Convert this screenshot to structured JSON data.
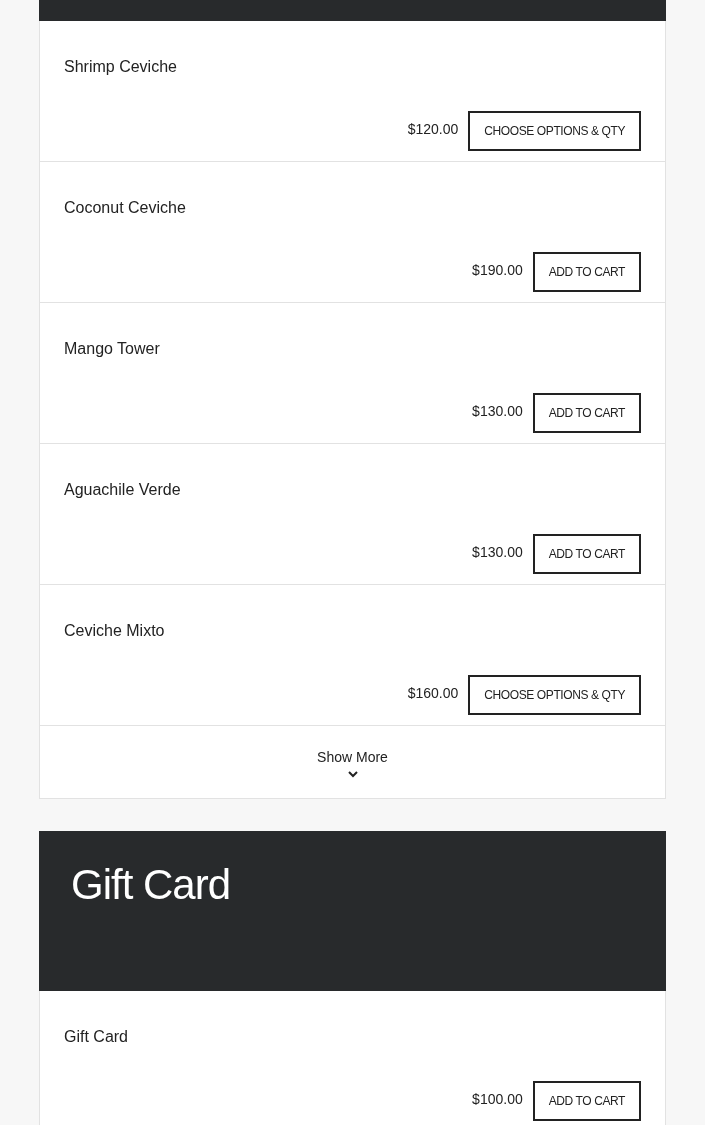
{
  "sections": [
    {
      "items": [
        {
          "name": "Shrimp Ceviche",
          "price": "$120.00",
          "button": "CHOOSE OPTIONS & QTY"
        },
        {
          "name": "Coconut Ceviche",
          "price": "$190.00",
          "button": "ADD TO CART"
        },
        {
          "name": "Mango Tower",
          "price": "$130.00",
          "button": "ADD TO CART"
        },
        {
          "name": "Aguachile Verde",
          "price": "$130.00",
          "button": "ADD TO CART"
        },
        {
          "name": "Ceviche Mixto",
          "price": "$160.00",
          "button": "CHOOSE OPTIONS & QTY"
        }
      ],
      "show_more": "Show More"
    },
    {
      "title": "Gift Card",
      "items": [
        {
          "name": "Gift Card",
          "price": "$100.00",
          "button": "ADD TO CART"
        }
      ]
    }
  ]
}
